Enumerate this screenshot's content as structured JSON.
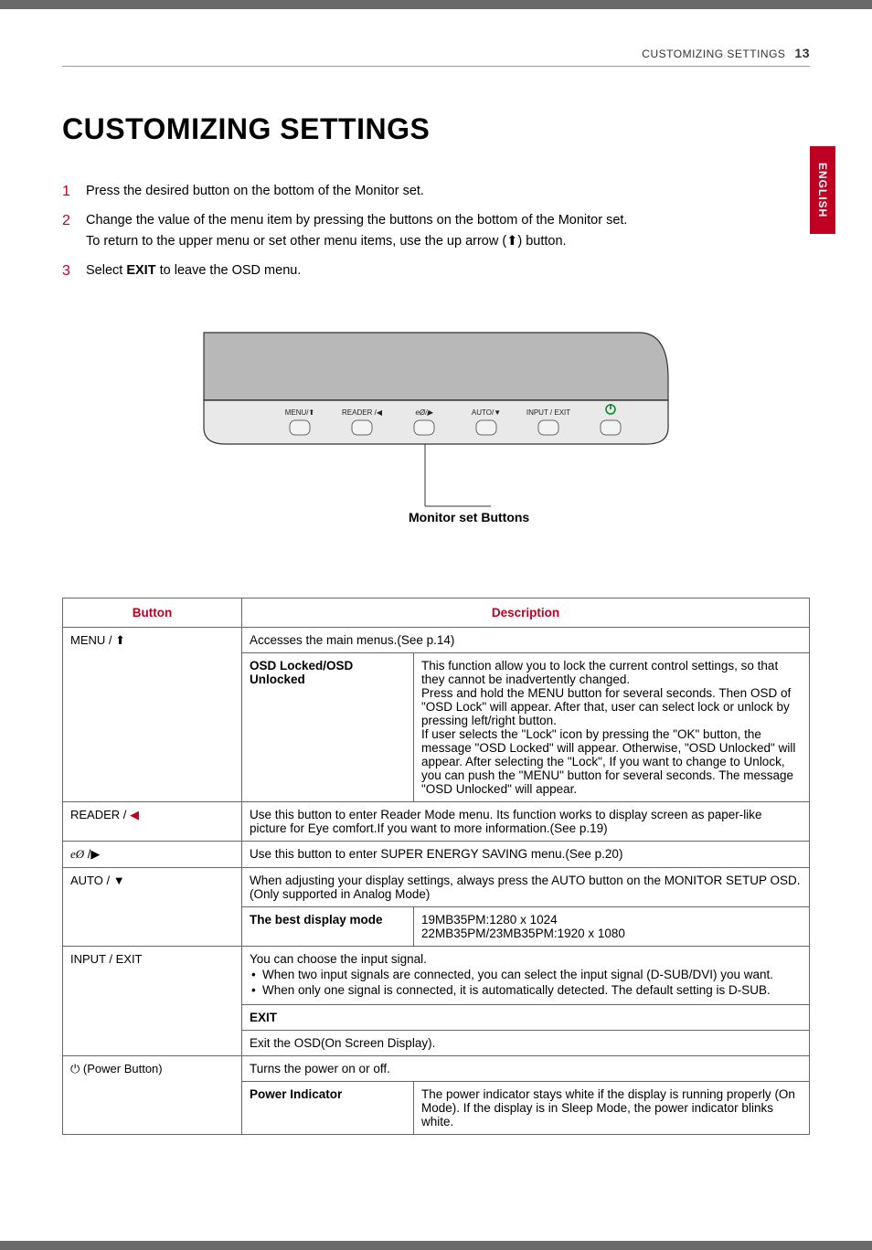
{
  "header": {
    "section": "CUSTOMIZING SETTINGS",
    "page_number": "13"
  },
  "lang_tab": "ENGLISH",
  "title": "CUSTOMIZING SETTINGS",
  "steps": {
    "s1": {
      "num": "1",
      "text": "Press the desired button on the bottom of the Monitor set."
    },
    "s2": {
      "num": "2",
      "line1": "Change the value of the menu item by pressing the buttons on the bottom of the Monitor set.",
      "line2_a": "To return to the upper menu or set other menu items, use the up arrow (",
      "line2_b": ") button."
    },
    "s3": {
      "num": "3",
      "text_a": "Select ",
      "exit": "EXIT",
      "text_b": " to leave the OSD menu."
    }
  },
  "figure": {
    "btn1": "MENU/",
    "btn2": "READER /",
    "btn3": "/",
    "btn4": "AUTO/",
    "btn5": "INPUT / EXIT",
    "caption": "Monitor set Buttons"
  },
  "table": {
    "head_button": "Button",
    "head_desc": "Description",
    "menu": {
      "label": "MENU / ",
      "row1": "Accesses the main menus.(See p.14)",
      "osd_label": "OSD Locked/OSD Unlocked",
      "osd_text": "This function allow you to lock the current control settings, so that they cannot be inadvertently changed.\nPress and hold the MENU button for several seconds. Then OSD of \"OSD Lock\" will appear. After that, user can select lock or unlock by pressing left/right button.\nIf user selects the \"Lock\" icon by pressing the \"OK\" button, the message \"OSD Locked\" will appear. Otherwise, \"OSD Unlocked\" will appear. After selecting the \"Lock\", If you want to change to Unlock, you can push the \"MENU\" button for several seconds. The message \"OSD Unlocked\" will appear."
    },
    "reader": {
      "label": "READER / ",
      "text": "Use this button to enter Reader Mode menu. Its function works to display screen as paper-like picture for Eye comfort.If you want to more information.(See p.19)"
    },
    "eco": {
      "text": "Use this button to enter SUPER ENERGY SAVING menu.(See p.20)"
    },
    "auto": {
      "label": "AUTO / ▼",
      "row1": "When adjusting your display settings, always press the AUTO button on the MONITOR SETUP OSD. (Only supported in Analog Mode)",
      "best_label": "The best display mode",
      "best_text": "19MB35PM:1280 x 1024\n22MB35PM/23MB35PM:1920 x 1080"
    },
    "input": {
      "label": "INPUT / EXIT",
      "intro": "You can choose the input signal.",
      "b1": "When two input signals are connected, you can select the input signal (D-SUB/DVI) you want.",
      "b2": "When only one signal is connected, it is automatically detected. The default setting is D-SUB.",
      "exit_label": "EXIT",
      "exit_text": "Exit the OSD(On Screen Display)."
    },
    "power": {
      "label": " (Power Button)",
      "row1": "Turns the power on or off.",
      "ind_label": "Power Indicator",
      "ind_text": "The power indicator stays white if the display is running properly (On Mode). If the display is in Sleep Mode, the power indicator blinks white."
    }
  }
}
